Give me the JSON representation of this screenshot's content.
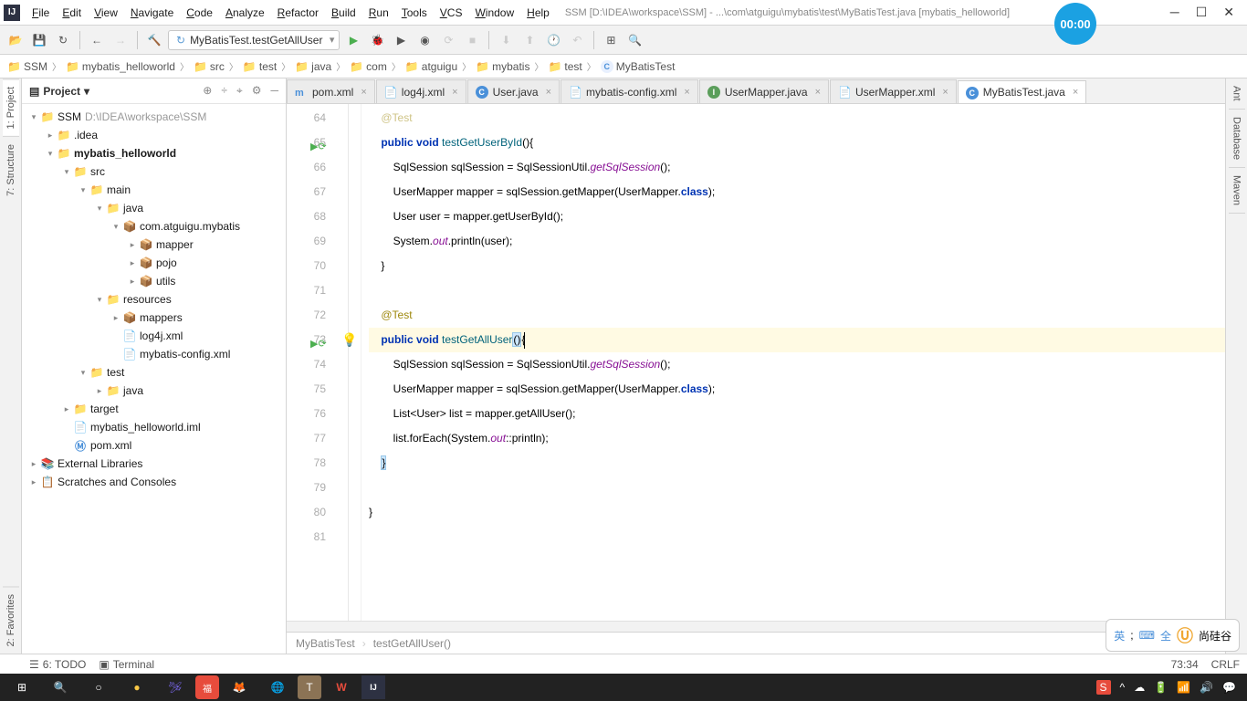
{
  "window": {
    "title": "SSM [D:\\IDEA\\workspace\\SSM] - ...\\com\\atguigu\\mybatis\\test\\MyBatisTest.java [mybatis_helloworld]",
    "timer": "00:00"
  },
  "menu": [
    "File",
    "Edit",
    "View",
    "Navigate",
    "Code",
    "Analyze",
    "Refactor",
    "Build",
    "Run",
    "Tools",
    "VCS",
    "Window",
    "Help"
  ],
  "toolbar": {
    "config": "MyBatisTest.testGetAllUser"
  },
  "breadcrumb": [
    {
      "icon": "project",
      "label": "SSM"
    },
    {
      "icon": "module",
      "label": "mybatis_helloworld"
    },
    {
      "icon": "folder",
      "label": "src"
    },
    {
      "icon": "folder",
      "label": "test"
    },
    {
      "icon": "folder",
      "label": "java"
    },
    {
      "icon": "folder",
      "label": "com"
    },
    {
      "icon": "folder",
      "label": "atguigu"
    },
    {
      "icon": "folder",
      "label": "mybatis"
    },
    {
      "icon": "folder",
      "label": "test"
    },
    {
      "icon": "class",
      "label": "MyBatisTest"
    }
  ],
  "project": {
    "title": "Project",
    "tree": [
      {
        "d": 0,
        "a": "▾",
        "i": "project",
        "l": "SSM",
        "h": "D:\\IDEA\\workspace\\SSM"
      },
      {
        "d": 1,
        "a": "▸",
        "i": "folder",
        "l": ".idea"
      },
      {
        "d": 1,
        "a": "▾",
        "i": "module",
        "l": "mybatis_helloworld",
        "bold": true
      },
      {
        "d": 2,
        "a": "▾",
        "i": "folder",
        "l": "src"
      },
      {
        "d": 3,
        "a": "▾",
        "i": "folder",
        "l": "main"
      },
      {
        "d": 4,
        "a": "▾",
        "i": "src-folder",
        "l": "java"
      },
      {
        "d": 5,
        "a": "▾",
        "i": "package",
        "l": "com.atguigu.mybatis"
      },
      {
        "d": 6,
        "a": "▸",
        "i": "package",
        "l": "mapper"
      },
      {
        "d": 6,
        "a": "▸",
        "i": "package",
        "l": "pojo"
      },
      {
        "d": 6,
        "a": "▸",
        "i": "package",
        "l": "utils"
      },
      {
        "d": 4,
        "a": "▾",
        "i": "res-folder",
        "l": "resources"
      },
      {
        "d": 5,
        "a": "▸",
        "i": "package",
        "l": "mappers"
      },
      {
        "d": 5,
        "a": "",
        "i": "xml",
        "l": "log4j.xml"
      },
      {
        "d": 5,
        "a": "",
        "i": "xml",
        "l": "mybatis-config.xml"
      },
      {
        "d": 3,
        "a": "▾",
        "i": "folder",
        "l": "test"
      },
      {
        "d": 4,
        "a": "▸",
        "i": "src-folder",
        "l": "java"
      },
      {
        "d": 2,
        "a": "▸",
        "i": "target",
        "l": "target"
      },
      {
        "d": 2,
        "a": "",
        "i": "file",
        "l": "mybatis_helloworld.iml"
      },
      {
        "d": 2,
        "a": "",
        "i": "maven",
        "l": "pom.xml"
      },
      {
        "d": 0,
        "a": "▸",
        "i": "lib",
        "l": "External Libraries"
      },
      {
        "d": 0,
        "a": "▸",
        "i": "scratch",
        "l": "Scratches and Consoles"
      }
    ]
  },
  "tabs": [
    {
      "icon": "maven",
      "label": "pom.xml",
      "active": false
    },
    {
      "icon": "xml",
      "label": "log4j.xml",
      "active": false
    },
    {
      "icon": "class",
      "label": "User.java",
      "active": false
    },
    {
      "icon": "xml",
      "label": "mybatis-config.xml",
      "active": false
    },
    {
      "icon": "interface",
      "label": "UserMapper.java",
      "active": false
    },
    {
      "icon": "xml",
      "label": "UserMapper.xml",
      "active": false
    },
    {
      "icon": "class",
      "label": "MyBatisTest.java",
      "active": true
    }
  ],
  "code": {
    "start": 64,
    "lines": [
      {
        "n": 64,
        "html": "    <span class='ann'>@Test</span>",
        "fade": true
      },
      {
        "n": 65,
        "html": "    <span class='kw'>public</span> <span class='kw'>void</span> <span class='mtd'>testGetUserById</span>(){",
        "run": true
      },
      {
        "n": 66,
        "html": "        SqlSession sqlSession = SqlSessionUtil.<span class='fld'>getSqlSession</span>();"
      },
      {
        "n": 67,
        "html": "        UserMapper mapper = sqlSession.getMapper(UserMapper.<span class='kw'>class</span>);"
      },
      {
        "n": 68,
        "html": "        User user = mapper.getUserById();"
      },
      {
        "n": 69,
        "html": "        System.<span class='fld'>out</span>.println(user);"
      },
      {
        "n": 70,
        "html": "    }"
      },
      {
        "n": 71,
        "html": ""
      },
      {
        "n": 72,
        "html": "    <span class='ann'>@Test</span>"
      },
      {
        "n": 73,
        "html": "    <span class='kw'>public</span> <span class='kw'>void</span> <span class='mtd'>testGetAllUser</span><span class='sel-brace'>()</span>{<span class='cursor-caret'></span>",
        "hl": true,
        "run": true,
        "bulb": true
      },
      {
        "n": 74,
        "html": "        SqlSession sqlSession = SqlSessionUtil.<span class='fld'>getSqlSession</span>();"
      },
      {
        "n": 75,
        "html": "        UserMapper mapper = sqlSession.getMapper(UserMapper.<span class='kw'>class</span>);"
      },
      {
        "n": 76,
        "html": "        List&lt;User&gt; list = mapper.getAllUser();"
      },
      {
        "n": 77,
        "html": "        list.forEach(System.<span class='fld'>out</span>::println);"
      },
      {
        "n": 78,
        "html": "    <span class='sel-brace'>}</span>"
      },
      {
        "n": 79,
        "html": ""
      },
      {
        "n": 80,
        "html": "}"
      },
      {
        "n": 81,
        "html": ""
      }
    ]
  },
  "editorCrumb": [
    "MyBatisTest",
    "testGetAllUser()"
  ],
  "statusbar": {
    "left": [
      {
        "i": "todo",
        "l": "6: TODO"
      },
      {
        "i": "terminal",
        "l": "Terminal"
      }
    ],
    "right": [
      "73:34",
      "CRLF"
    ]
  },
  "ime": {
    "lang": "英",
    "full": "全",
    "brand": "尚硅谷"
  },
  "sidebarLeft": [
    "1: Project",
    "7: Structure",
    "2: Favorites"
  ],
  "sidebarRight": [
    "Ant",
    "Database",
    "Maven"
  ]
}
